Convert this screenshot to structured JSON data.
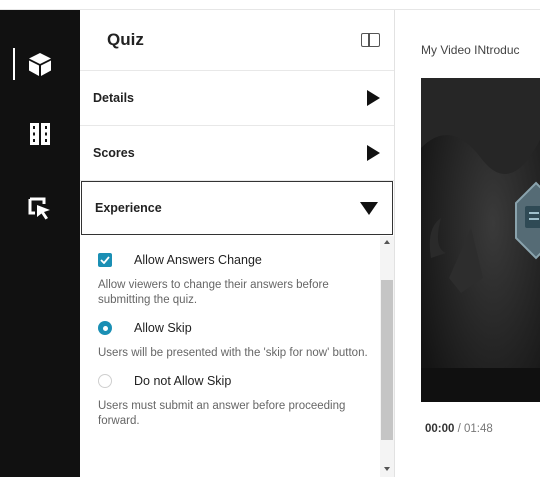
{
  "rail": {
    "items": [
      {
        "name": "cube",
        "active": true
      },
      {
        "name": "film",
        "active": false
      },
      {
        "name": "cursor-select",
        "active": false
      }
    ]
  },
  "panel": {
    "title": "Quiz",
    "sections": [
      {
        "label": "Details",
        "expanded": false
      },
      {
        "label": "Scores",
        "expanded": false
      },
      {
        "label": "Experience",
        "expanded": true
      }
    ],
    "experience": {
      "allow_answers_change": {
        "label": "Allow Answers Change",
        "checked": true,
        "help": "Allow viewers to change their answers before submitting the quiz."
      },
      "allow_skip": {
        "label": "Allow Skip",
        "selected": true,
        "help": "Users will be presented with the 'skip for now' button."
      },
      "no_skip": {
        "label": "Do not Allow Skip",
        "selected": false,
        "help": "Users must submit an answer before proceeding forward."
      }
    }
  },
  "video": {
    "title": "My Video INtroduc",
    "current_time": "00:00",
    "separator": " / ",
    "duration": "01:48"
  },
  "colors": {
    "accent": "#1a8fb4",
    "rail": "#111111"
  }
}
